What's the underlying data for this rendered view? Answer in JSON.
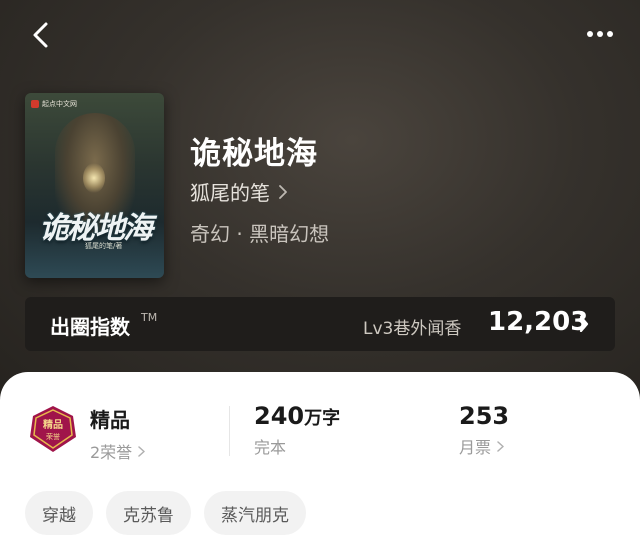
{
  "nav": {
    "back_icon": "chevron-left-icon",
    "more_icon": "more-dots-icon"
  },
  "book": {
    "cover_publisher": "起点中文网",
    "cover_title": "诡秘地海",
    "cover_author": "狐尾的笔/著",
    "title": "诡秘地海",
    "author": "狐尾的笔",
    "genre": "奇幻 · 黑暗幻想"
  },
  "index": {
    "label": "出圈指数",
    "tm": "TM",
    "level": "Lv3巷外闻香",
    "value": "12,203"
  },
  "stats": {
    "honor_title": "精品",
    "honor_sub": "2荣誉",
    "words_num": "240",
    "words_unit": "万字",
    "words_status": "完本",
    "votes_num": "253",
    "votes_sub": "月票"
  },
  "tags": [
    "穿越",
    "克苏鲁",
    "蒸汽朋克"
  ],
  "colors": {
    "badge_primary": "#a0144a",
    "badge_gold": "#e7b94c",
    "accent_sheet": "#ffffff"
  }
}
